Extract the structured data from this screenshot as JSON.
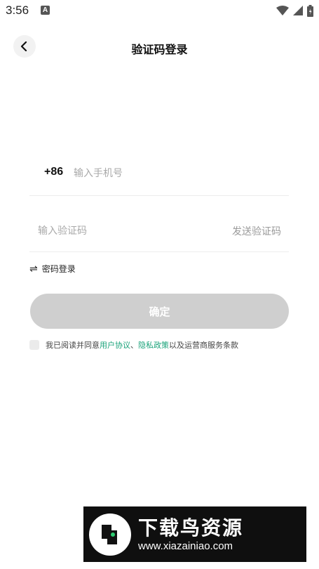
{
  "status_bar": {
    "time": "3:56",
    "notification_letter": "A"
  },
  "header": {
    "title": "验证码登录"
  },
  "phone_field": {
    "country_code": "+86",
    "placeholder": "输入手机号",
    "value": ""
  },
  "code_field": {
    "placeholder": "输入验证码",
    "value": "",
    "send_label": "发送验证码"
  },
  "switch_login": {
    "label": "密码登录"
  },
  "confirm_button": {
    "label": "确定"
  },
  "agreement": {
    "prefix": "我已阅读并同意",
    "link1": "用户协议",
    "separator": "、",
    "link2": "隐私政策",
    "suffix": "以及运营商服务条款",
    "checked": false
  },
  "watermark": {
    "title": "下载鸟资源",
    "url": "www.xiazainiao.com"
  },
  "colors": {
    "link": "#1aa37a",
    "button_disabled": "#cfcfcf",
    "divider": "#ececec"
  },
  "icons": [
    "back-arrow-icon",
    "wifi-icon",
    "signal-icon",
    "battery-icon",
    "swap-icon"
  ]
}
